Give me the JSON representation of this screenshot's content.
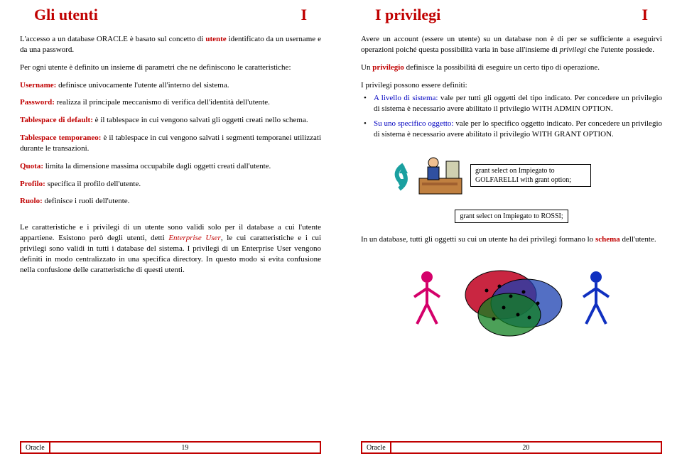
{
  "left": {
    "title_main": "Gli utenti",
    "title_num": "I",
    "p1a": "L'accesso a un database ORACLE è basato sul concetto di ",
    "p1b": "utente",
    "p1c": " identificato da un username e da una password.",
    "p2": "Per ogni utente è definito un insieme di parametri che ne definiscono le caratteristiche:",
    "fields": {
      "username_k": "Username:",
      "username_t": " definisce univocamente l'utente all'interno del sistema.",
      "password_k": "Password:",
      "password_t": " realizza il principale meccanismo di verifica dell'identità dell'utente.",
      "tsdefault_k": "Tablespace di default:",
      "tsdefault_t": " è il tablespace in cui vengono salvati gli oggetti creati nello schema.",
      "tstemp_k": "Tablespace temporaneo:",
      "tstemp_t": " è il tablespace in cui vengono salvati i segmenti temporanei utilizzati durante le transazioni.",
      "quota_k": "Quota:",
      "quota_t": " limita la dimensione massima occupabile dagli oggetti creati dall'utente.",
      "profilo_k": "Profilo:",
      "profilo_t": " specifica il profilo dell'utente.",
      "ruolo_k": "Ruolo:",
      "ruolo_t": " definisce i ruoli dell'utente."
    },
    "p3a": "Le caratteristiche e i privilegi di un utente sono validi solo per il database a cui l'utente appartiene. Esistono però degli utenti, detti ",
    "p3b": "Enterprise User",
    "p3c": ", le cui caratteristiche e i cui privilegi sono validi in tutti i database del sistema. I privilegi di un Enterprise User vengono definiti in modo centralizzato in una specifica directory. In questo modo si evita confusione nella confusione delle caratteristiche di questi utenti.",
    "footer_label": "Oracle",
    "footer_page": "19"
  },
  "right": {
    "title_main": "I privilegi",
    "title_num": "I",
    "p1a": "Avere un account (essere un utente) su un database non è di per se sufficiente a eseguirvi operazioni poiché questa possibilità varia in base all'insieme di ",
    "p1b": "privilegi",
    "p1c": " che l'utente possiede.",
    "p2a": "Un ",
    "p2b": "privilegio",
    "p2c": " definisce la possibilità di eseguire un certo tipo di operazione.",
    "p3": "I privilegi possono essere definiti:",
    "bul1a": "A livello di sistema:",
    "bul1b": " vale per tutti gli oggetti del tipo indicato. Per concedere un privilegio di sistema è necessario avere abilitato il privilegio WITH ADMIN OPTION.",
    "bul2a": "Su uno specifico oggetto:",
    "bul2b": " vale per lo specifico oggetto indicato. Per concedere un privilegio di sistema è necessario avere abilitato il privilegio WITH GRANT OPTION.",
    "code1": "grant select on Impiegato to GOLFARELLI with grant option;",
    "code2": "grant select on Impiegato to ROSSI;",
    "p4a": "In un database, tutti gli oggetti su cui un utente ha dei privilegi formano lo ",
    "p4b": "schema",
    "p4c": " dell'utente.",
    "footer_label": "Oracle",
    "footer_page": "20"
  }
}
